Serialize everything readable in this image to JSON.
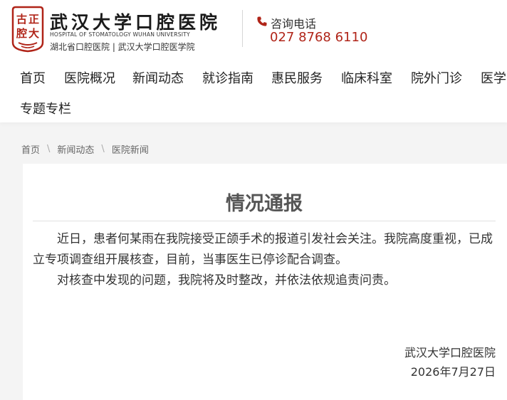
{
  "hospital": {
    "name_cn": "武汉大学口腔医院",
    "name_en": "HOSPITAL OF STOMATOLOGY WUHAN UNIVERSITY",
    "subtitle": "湖北省口腔医院 | 武汉大学口腔医学院"
  },
  "hotline": {
    "label": "咨询电话",
    "number": "027 8768 6110"
  },
  "nav": {
    "items": [
      {
        "label": "首页"
      },
      {
        "label": "医院概况"
      },
      {
        "label": "新闻动态"
      },
      {
        "label": "就诊指南"
      },
      {
        "label": "惠民服务"
      },
      {
        "label": "临床科室"
      },
      {
        "label": "院外门诊"
      },
      {
        "label": "医学"
      },
      {
        "label": "专题专栏"
      }
    ]
  },
  "breadcrumb": {
    "items": [
      {
        "label": "首页"
      },
      {
        "label": "新闻动态"
      },
      {
        "label": "医院新闻"
      }
    ],
    "separator": "\\"
  },
  "article": {
    "title": "情况通报",
    "paragraphs": [
      "近日，患者何某雨在我院接受正颌手术的报道引发社会关注。我院高度重视，已成立专项调查组开展核查，目前，当事医生已停诊配合调查。",
      "对核查中发现的问题，我院将及时整改，并依法依规追责问责。"
    ],
    "signature": "武汉大学口腔医院",
    "date": "2026年7月27日"
  },
  "colors": {
    "brand_red": "#b02418",
    "text": "#333333",
    "title_gray": "#555555"
  },
  "icons": {
    "hotline": "phone-icon",
    "logo": "hospital-emblem-icon"
  }
}
